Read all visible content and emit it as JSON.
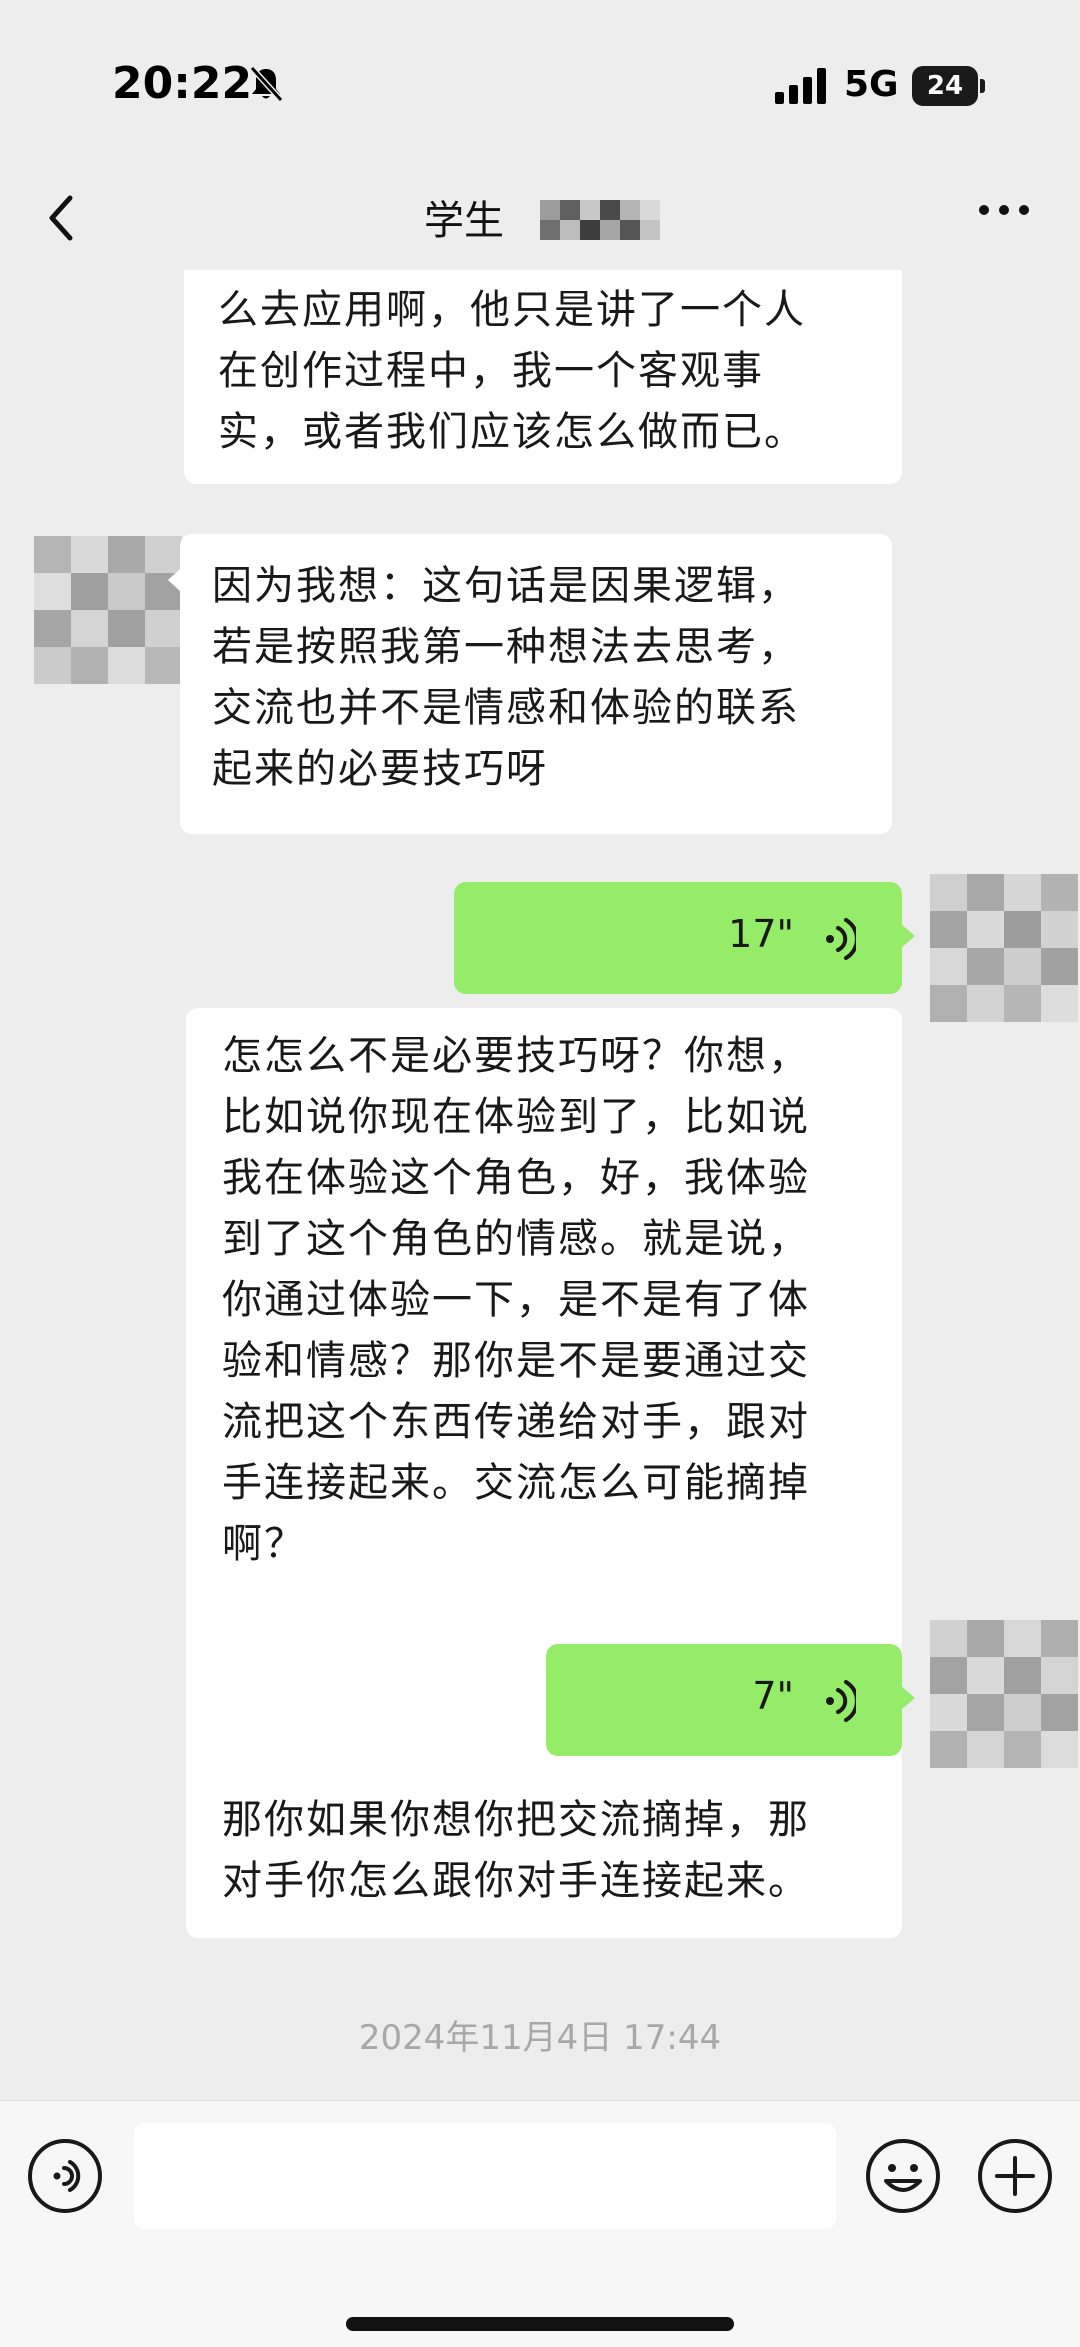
{
  "status_bar": {
    "time": "20:22",
    "network": "5G",
    "battery": "24",
    "icons": [
      "bell-off-icon",
      "signal-icon",
      "battery-icon"
    ]
  },
  "nav": {
    "title": "学生",
    "icons": [
      "back-icon",
      "more-icon"
    ]
  },
  "messages": [
    {
      "direction": "incoming",
      "type": "text",
      "text": "么去应用啊，他只是讲了一个人\n在创作过程中，我一个客观事\n实，或者我们应该怎么做而已。"
    },
    {
      "direction": "incoming",
      "type": "text",
      "text": "因为我想：这句话是因果逻辑，\n若是按照我第一种想法去思考，\n交流也并不是情感和体验的联系\n起来的必要技巧呀"
    },
    {
      "direction": "outgoing",
      "type": "voice",
      "duration": "17\""
    },
    {
      "direction": "incoming",
      "type": "text",
      "text": "怎怎么不是必要技巧呀？你想，\n比如说你现在体验到了，比如说\n我在体验这个角色，好，我体验\n到了这个角色的情感。就是说，\n你通过体验一下，是不是有了体\n验和情感？那你是不是要通过交\n流把这个东西传递给对手，跟对\n手连接起来。交流怎么可能摘掉\n啊？"
    },
    {
      "direction": "outgoing",
      "type": "voice",
      "duration": "7\""
    },
    {
      "direction": "incoming",
      "type": "text",
      "text": "那你如果你想你把交流摘掉，那\n对手你怎么跟你对手连接起来。"
    }
  ],
  "timestamp": "2024年11月4日 17:44",
  "input_bar": {
    "value": "",
    "icons": [
      "voice-mode-icon",
      "emoji-icon",
      "plus-icon"
    ]
  },
  "colors": {
    "background": "#ededed",
    "incoming_bubble": "#ffffff",
    "outgoing_bubble": "#95ec69",
    "timestamp_text": "#a8a8a8"
  }
}
